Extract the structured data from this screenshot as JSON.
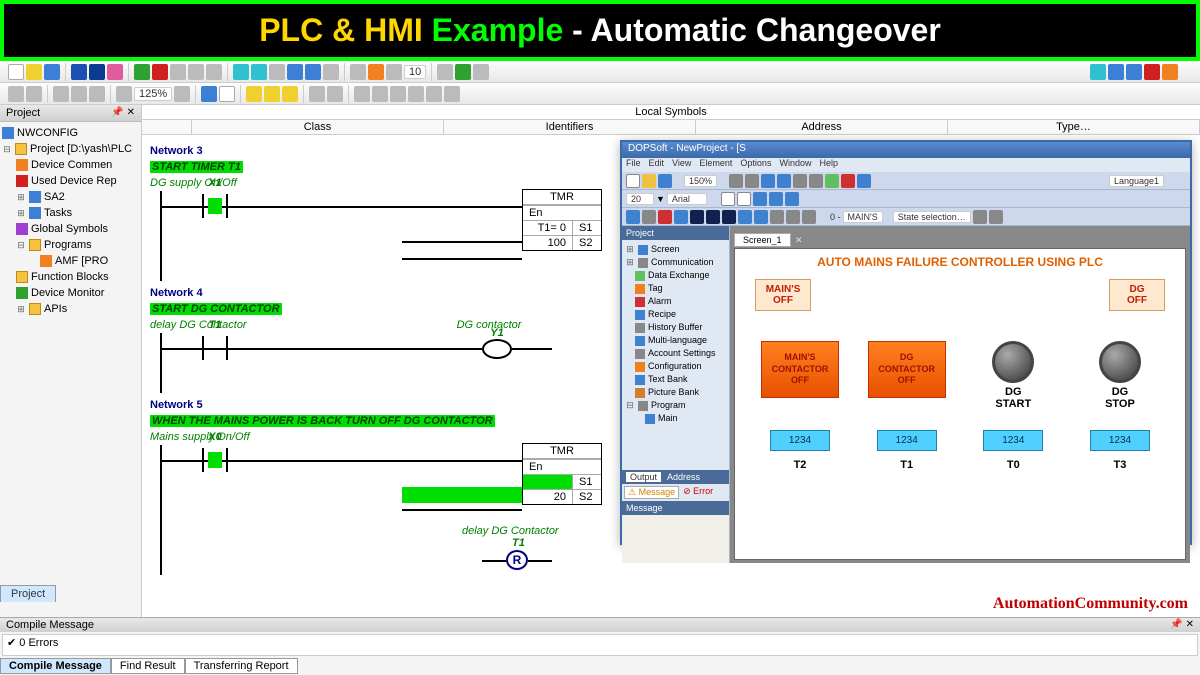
{
  "banner": {
    "p1": "PLC & HMI ",
    "p2": "Example ",
    "p3": "- ",
    "p4": "Automatic Changeover"
  },
  "toolbar": {
    "zoom": "125%",
    "v10": "10"
  },
  "projectPanel": {
    "title": "Project"
  },
  "tree": {
    "nwconfig": "NWCONFIG",
    "project": "Project [D:\\yash\\PLC",
    "deviceComment": "Device Commen",
    "usedDevice": "Used Device Rep",
    "sa2": "SA2",
    "tasks": "Tasks",
    "globalSym": "Global Symbols",
    "programs": "Programs",
    "amf": "AMF [PRO",
    "funcBlocks": "Function Blocks",
    "deviceMon": "Device Monitor",
    "apis": "APIs"
  },
  "sidebarTab": "Project",
  "editor": {
    "localSymbols": "Local Symbols",
    "cols": {
      "class": "Class",
      "identifiers": "Identifiers",
      "address": "Address",
      "type": "Type…"
    }
  },
  "net3": {
    "title": "Network 3",
    "desc": "START TIMER T1",
    "comment": "DG supply On/Off",
    "x1": "X1",
    "tmr": "TMR",
    "en": "En",
    "s1": "S1",
    "s2": "S2",
    "t1eq": "T1= 0",
    "v100": "100"
  },
  "net4": {
    "title": "Network 4",
    "desc": "START DG CONTACTOR",
    "comment": "delay DG Contactor",
    "rightComment": "DG contactor",
    "t1": "T1",
    "y1": "Y1"
  },
  "net5": {
    "title": "Network 5",
    "desc": "WHEN THE MAINS POWER IS BACK TURN OFF DG CONTACTOR",
    "comment": "Mains supply On/Off",
    "x0": "X0",
    "tmr": "TMR",
    "en": "En",
    "s1": "S1",
    "s2": "S2",
    "blank": "",
    "v20": "20",
    "delay": "delay DG Contactor",
    "t1": "T1",
    "r": "R"
  },
  "hmi": {
    "title": "DOPSoft - NewProject - [S",
    "menu": {
      "file": "File",
      "edit": "Edit",
      "view": "View",
      "element": "Element",
      "options": "Options",
      "window": "Window",
      "help": "Help"
    },
    "zoom": "150%",
    "font": "Arial",
    "fsize": "20",
    "mains": "MAIN'S",
    "state": "State selection…",
    "lang": "Language1",
    "sideTop": "Project",
    "treeItems": {
      "screen": "Screen",
      "comm": "Communication",
      "dataex": "Data Exchange",
      "tag": "Tag",
      "alarm": "Alarm",
      "recipe": "Recipe",
      "histbuf": "History Buffer",
      "multilang": "Multi-language",
      "account": "Account Settings",
      "config": "Configuration",
      "textbank": "Text Bank",
      "picbank": "Picture Bank",
      "program": "Program",
      "main": "Main"
    },
    "outputTab": "Output",
    "addressTab": "Address",
    "msgTab": "Message",
    "errTab": "Error",
    "msgLabel": "Message",
    "screenTab": "Screen_1",
    "canvasTitle": "AUTO MAINS FAILURE CONTROLLER USING PLC",
    "mainsOff": "MAIN'S\nOFF",
    "dgOff": "DG\nOFF",
    "mainsCont": "MAIN'S\nCONTACTOR\nOFF",
    "dgCont": "DG\nCONTACTOR\nOFF",
    "dgStart": "DG\nSTART",
    "dgStop": "DG\nSTOP",
    "num": "1234",
    "t0": "T0",
    "t1": "T1",
    "t2": "T2",
    "t3": "T3"
  },
  "compile": {
    "title": "Compile Message",
    "errors": "✔ 0 Errors",
    "tab1": "Compile Message",
    "tab2": "Find Result",
    "tab3": "Transferring Report"
  },
  "watermark": "AutomationCommunity.com"
}
